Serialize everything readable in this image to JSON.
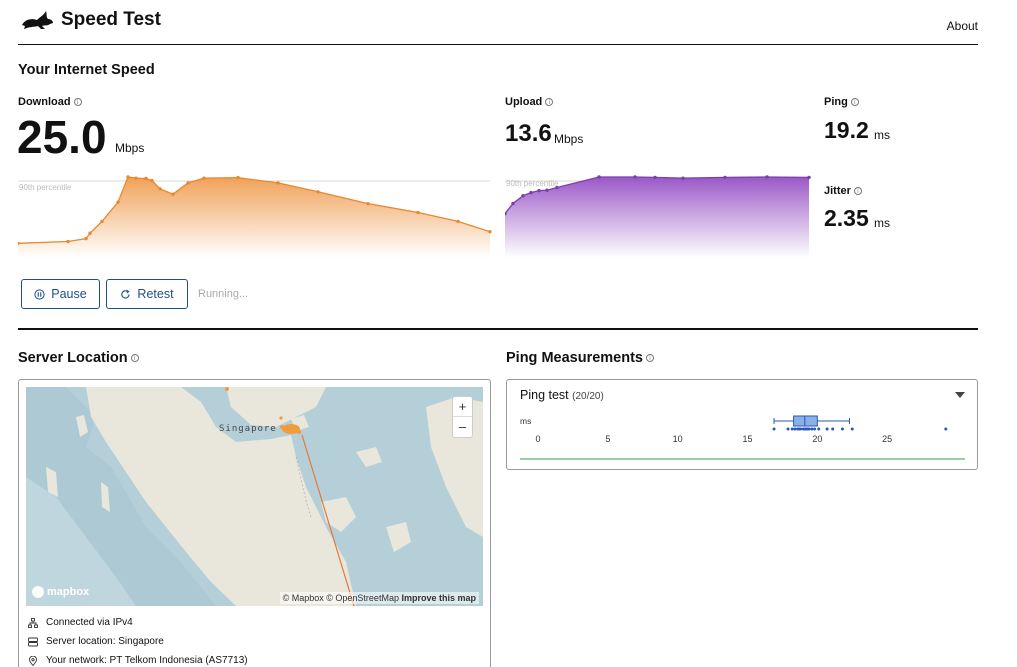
{
  "header": {
    "title": "Speed Test",
    "about": "About"
  },
  "speed": {
    "title": "Your Internet Speed",
    "download": {
      "label": "Download",
      "value": "25.0",
      "unit": "Mbps"
    },
    "upload": {
      "label": "Upload",
      "value": "13.6",
      "unit": "Mbps"
    },
    "ping": {
      "label": "Ping",
      "value": "19.2",
      "unit": "ms"
    },
    "jitter": {
      "label": "Jitter",
      "value": "2.35",
      "unit": "ms"
    },
    "percentile_label": "90th percentile",
    "download_color": "#f0a158",
    "upload_color": "#9b59c8"
  },
  "controls": {
    "pause": "Pause",
    "retest": "Retest",
    "status": "Running..."
  },
  "server": {
    "title": "Server Location",
    "city": "Singapore",
    "mapbox": "mapbox",
    "attribution_mapbox": "© Mapbox",
    "attribution_osm": "© OpenStreetMap",
    "attribution_improve": "Improve this map",
    "connection": "Connected via IPv4",
    "server_location": "Server location: Singapore",
    "network": "Your network: PT Telkom Indonesia (AS7713)"
  },
  "ping_measurements": {
    "title": "Ping Measurements",
    "test_label": "Ping test",
    "test_count": "(20/20)",
    "axis_unit": "ms"
  },
  "chart_data": [
    {
      "type": "area",
      "title": "",
      "y_reference": "90th percentile",
      "series": [
        {
          "values": [
            2.6,
            3.2,
            4.2,
            6.0,
            10.0,
            16.5,
            25.0,
            24.6,
            24.5,
            23.8,
            21.0,
            19.2,
            23.0,
            24.6,
            24.8,
            23.0,
            20.0,
            16.0,
            13.0,
            10.0,
            6.5
          ]
        }
      ],
      "color": "#f0a158"
    },
    {
      "type": "area",
      "title": "",
      "y_reference": "90th percentile",
      "series": [
        {
          "values": [
            4.2,
            6.8,
            8.8,
            9.6,
            10.1,
            10.2,
            10.9,
            13.6,
            13.6,
            13.5,
            13.3,
            13.5,
            13.6,
            13.5
          ]
        }
      ],
      "color": "#9b59c8"
    },
    {
      "type": "scatter",
      "title": "Ping test",
      "xlabel": "ms",
      "x_ticks": [
        0,
        5,
        10,
        15,
        20,
        25
      ],
      "xlim": [
        0,
        30
      ],
      "box": {
        "min": 16.9,
        "q1": 18.3,
        "median": 19.1,
        "q3": 20.0,
        "max": 22.3
      },
      "values": [
        16.9,
        17.9,
        18.2,
        18.4,
        18.6,
        18.7,
        18.8,
        19.0,
        19.1,
        19.2,
        19.3,
        19.4,
        19.6,
        19.8,
        20.1,
        20.7,
        21.1,
        21.8,
        22.5,
        29.2
      ]
    }
  ]
}
